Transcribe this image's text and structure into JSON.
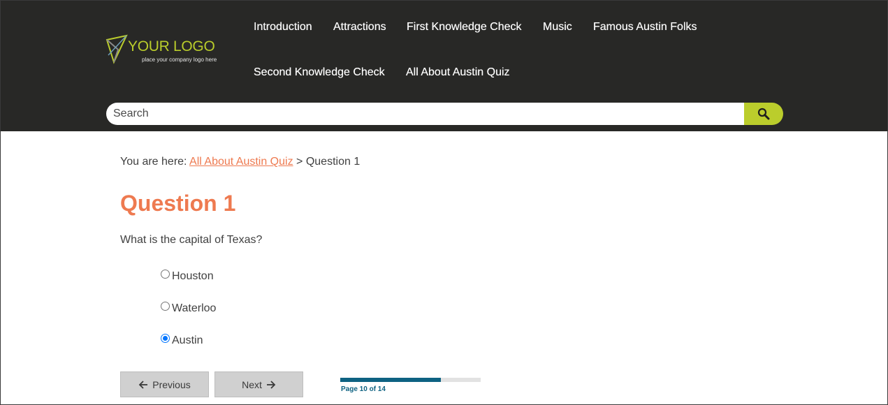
{
  "logo": {
    "title": "YOUR LOGO",
    "tagline": "place your company logo here"
  },
  "nav": {
    "items": [
      {
        "label": "Introduction"
      },
      {
        "label": "Attractions"
      },
      {
        "label": "First Knowledge Check"
      },
      {
        "label": "Music"
      },
      {
        "label": "Famous Austin Folks"
      },
      {
        "label": "Second Knowledge Check"
      },
      {
        "label": "All About Austin Quiz"
      }
    ]
  },
  "search": {
    "placeholder": "Search",
    "button_icon": "search-icon"
  },
  "breadcrumb": {
    "prefix": "You are here:",
    "link": "All About Austin Quiz",
    "separator": ">",
    "current": "Question 1"
  },
  "page": {
    "title": "Question 1",
    "question": "What is the capital of Texas?"
  },
  "options": [
    {
      "label": "Houston",
      "selected": false
    },
    {
      "label": "Waterloo",
      "selected": false
    },
    {
      "label": "Austin",
      "selected": true
    }
  ],
  "buttons": {
    "previous": "Previous",
    "next": "Next"
  },
  "progress": {
    "label": "Page 10 of 14",
    "current": 10,
    "total": 14
  },
  "colors": {
    "header_bg": "#282826",
    "accent_lime": "#bbcd2c",
    "accent_orange": "#ee7a50",
    "progress_blue": "#0e6282"
  }
}
